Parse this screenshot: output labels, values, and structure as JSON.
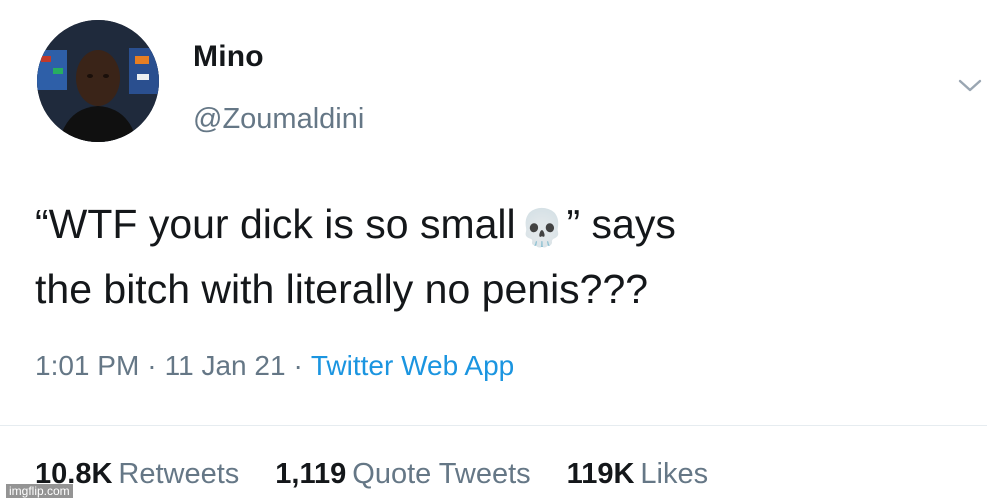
{
  "tweet": {
    "display_name": "Mino",
    "handle": "@Zoumaldini",
    "text_line1_before": "“WTF your dick is so small",
    "emoji": "💀",
    "text_line1_after": "” says",
    "text_line2": "the bitch with literally no penis???",
    "time": "1:01 PM",
    "date": "11 Jan 21",
    "separator": "·",
    "source": "Twitter Web App"
  },
  "stats": {
    "retweets_count": "10.8K",
    "retweets_label": "Retweets",
    "quotes_count": "1,119",
    "quotes_label": "Quote Tweets",
    "likes_count": "119K",
    "likes_label": "Likes"
  },
  "icons": {
    "caret": "chevron-down-icon"
  },
  "colors": {
    "text": "#14171a",
    "secondary": "#657786",
    "link": "#1b95e0"
  },
  "watermark": "imgflip.com"
}
